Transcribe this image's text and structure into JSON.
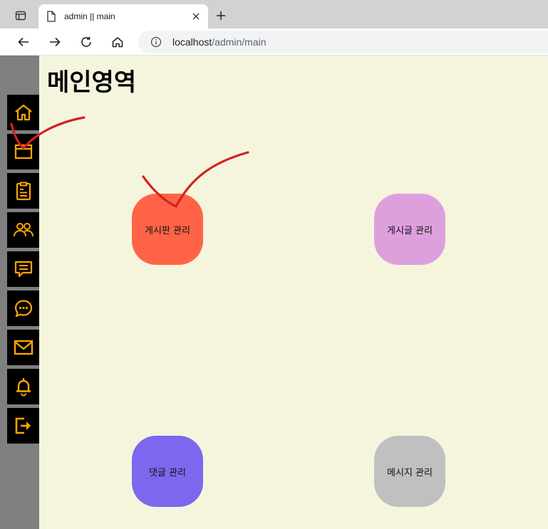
{
  "browser": {
    "tab_title": "admin || main",
    "url_host": "localhost",
    "url_path": "/admin/main"
  },
  "page": {
    "title": "메인영역"
  },
  "sidebar": {
    "icon_color": "#ffa500",
    "items": [
      {
        "icon": "home-icon"
      },
      {
        "icon": "window-icon"
      },
      {
        "icon": "clipboard-icon"
      },
      {
        "icon": "users-icon"
      },
      {
        "icon": "message-icon"
      },
      {
        "icon": "chat-bubble-icon"
      },
      {
        "icon": "mail-icon"
      },
      {
        "icon": "bell-icon"
      },
      {
        "icon": "logout-icon"
      }
    ]
  },
  "tiles": [
    {
      "label": "게시판 관리",
      "color": "#ff6347"
    },
    {
      "label": "게시글 관리",
      "color": "#dda0dd"
    },
    {
      "label": "댓글 관리",
      "color": "#7b68ee"
    },
    {
      "label": "메시지 관리",
      "color": "#c0c0c0"
    }
  ],
  "annotation_color": "#d42020"
}
